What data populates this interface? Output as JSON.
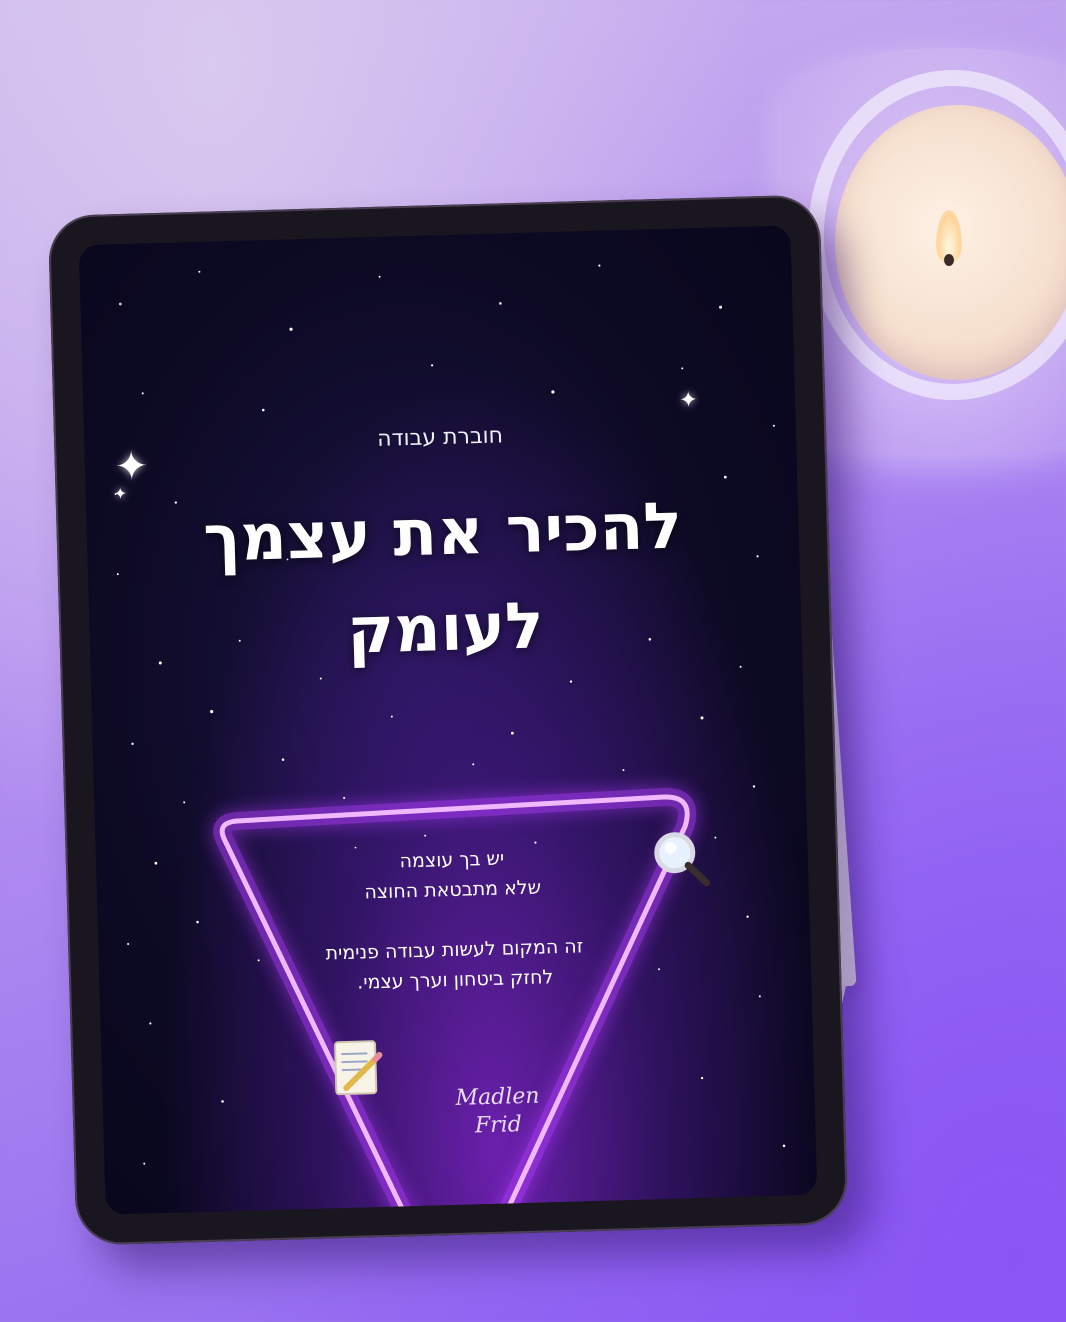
{
  "cover": {
    "subtitle": "חוברת עבודה",
    "title_line1": "להכיר את עצמך",
    "title_line2": "לעומק",
    "body_line1": "יש בך עוצמה",
    "body_line2": "שלא מתבטאת החוצה",
    "body_line3": "זה המקום לעשות עבודה פנימית",
    "body_line4": "לחזק ביטחון וערך עצמי.",
    "signature_line1": "Madlen",
    "signature_line2": "Frid"
  },
  "colors": {
    "background": "#a583f0",
    "screen": "#0d0a24",
    "neon": "#d06bff"
  },
  "icons": [
    "sparkle-icon",
    "magnifier-icon",
    "memo-icon",
    "candle",
    "stylus-pencil"
  ]
}
